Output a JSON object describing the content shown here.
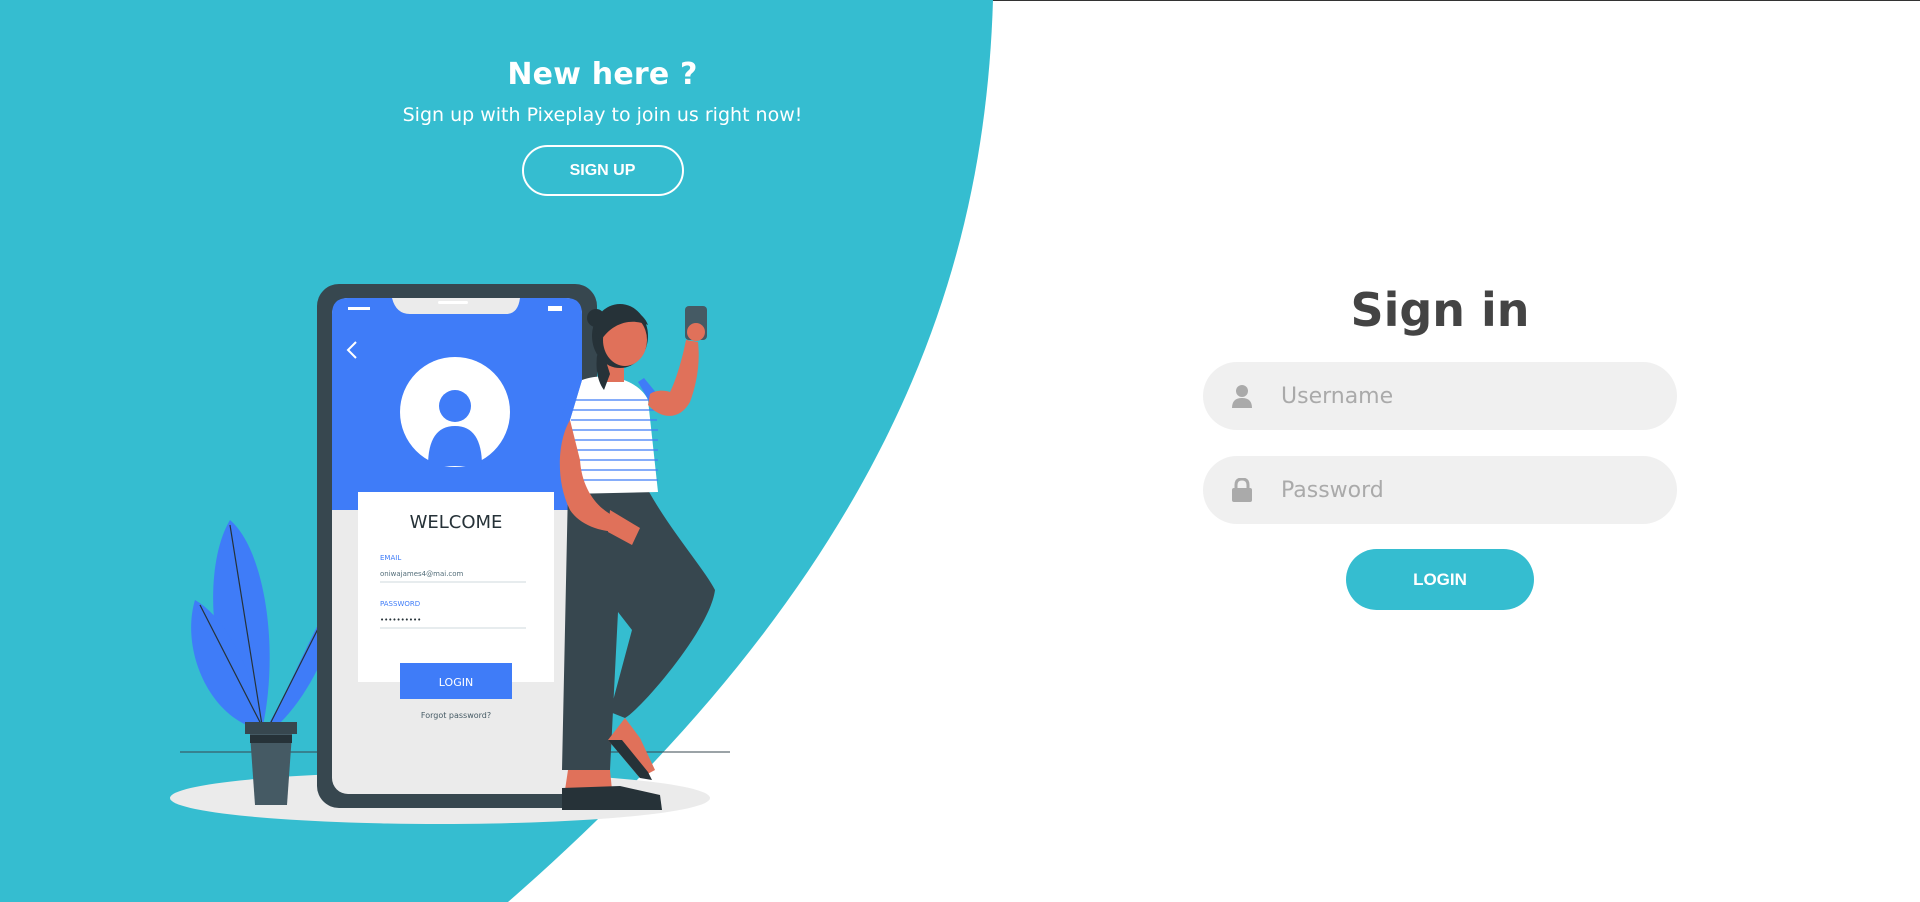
{
  "colors": {
    "accent": "#35bdd0",
    "phone_blue": "#3f7cf8",
    "dark": "#37474f",
    "skin": "#e0715a",
    "white": "#ffffff"
  },
  "panel": {
    "title": "New here ?",
    "text": "Sign up with Pixeplay to join us right now!",
    "signup_label": "SIGN UP"
  },
  "illustration": {
    "welcome": "WELCOME",
    "email_label": "EMAIL",
    "email_value": "oniwajames4@mai.com",
    "password_label": "PASSWORD",
    "password_value": "••••••••••",
    "login_label": "LOGIN",
    "forgot": "Forgot password?"
  },
  "signin": {
    "title": "Sign in",
    "username_placeholder": "Username",
    "password_placeholder": "Password",
    "login_label": "LOGIN",
    "username_icon": "user-icon",
    "password_icon": "lock-icon"
  }
}
